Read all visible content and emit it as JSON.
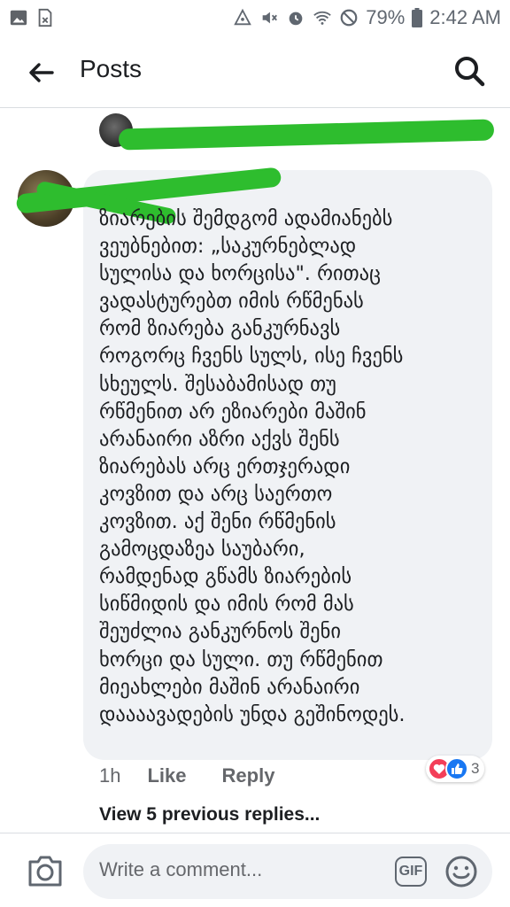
{
  "status_bar": {
    "battery": "79%",
    "time": "2:42 AM"
  },
  "header": {
    "title": "Posts"
  },
  "comment": {
    "text": "ზიარების შემდგომ ადამიანებს\nვეუბნებით: „საკურნებლად\nსულისა და ხორცისა\". რითაც\nვადასტურებთ იმის რწმენას\nრომ ზიარება განკურნავს\nროგორც ჩვენს სულს, ისე ჩვენს\nსხეულს. შესაბამისად თუ\nრწმენით არ ეზიარები მაშინ\nარანაირი აზრი აქვს შენს\nზიარებას  არც ერთჯერადი\nკოვზით და არც საერთო\nკოვზით. აქ შენი რწმენის\nგამოცდაზეა საუბარი,\nრამდენად გწამს ზიარების\nსიწმიდის და იმის რომ მას\nშეუძლია განკურნოს შენი\nხორცი და სული. თუ რწმენით\nმიეახლები მაშინ არანაირი\nდაააავადების უნდა გეშინოდეს.",
    "time": "1h",
    "like_label": "Like",
    "reply_label": "Reply",
    "reaction_count": "3"
  },
  "view_previous": "View 5 previous replies...",
  "composer": {
    "placeholder": "Write a comment...",
    "gif_label": "GIF"
  },
  "colors": {
    "green_redaction": "#2ebd2e",
    "bubble": "#f0f2f5",
    "like_blue": "#1877f2",
    "love_red": "#f33e58"
  },
  "icons": [
    "image-icon",
    "file-icon",
    "hotspot-icon",
    "mute-icon",
    "alarm-icon",
    "wifi-icon",
    "block-icon",
    "battery-icon",
    "back-arrow-icon",
    "search-icon",
    "camera-icon",
    "gif-icon",
    "emoji-icon",
    "love-reaction-icon",
    "like-reaction-icon"
  ]
}
